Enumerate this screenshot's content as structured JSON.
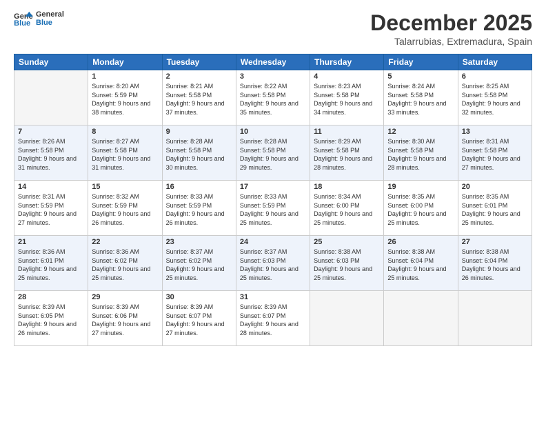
{
  "header": {
    "logo_line1": "General",
    "logo_line2": "Blue",
    "title": "December 2025",
    "subtitle": "Talarrubias, Extremadura, Spain"
  },
  "days_of_week": [
    "Sunday",
    "Monday",
    "Tuesday",
    "Wednesday",
    "Thursday",
    "Friday",
    "Saturday"
  ],
  "weeks": [
    [
      {
        "day": "",
        "sunrise": "",
        "sunset": "",
        "daylight": ""
      },
      {
        "day": "1",
        "sunrise": "Sunrise: 8:20 AM",
        "sunset": "Sunset: 5:59 PM",
        "daylight": "Daylight: 9 hours and 38 minutes."
      },
      {
        "day": "2",
        "sunrise": "Sunrise: 8:21 AM",
        "sunset": "Sunset: 5:58 PM",
        "daylight": "Daylight: 9 hours and 37 minutes."
      },
      {
        "day": "3",
        "sunrise": "Sunrise: 8:22 AM",
        "sunset": "Sunset: 5:58 PM",
        "daylight": "Daylight: 9 hours and 35 minutes."
      },
      {
        "day": "4",
        "sunrise": "Sunrise: 8:23 AM",
        "sunset": "Sunset: 5:58 PM",
        "daylight": "Daylight: 9 hours and 34 minutes."
      },
      {
        "day": "5",
        "sunrise": "Sunrise: 8:24 AM",
        "sunset": "Sunset: 5:58 PM",
        "daylight": "Daylight: 9 hours and 33 minutes."
      },
      {
        "day": "6",
        "sunrise": "Sunrise: 8:25 AM",
        "sunset": "Sunset: 5:58 PM",
        "daylight": "Daylight: 9 hours and 32 minutes."
      }
    ],
    [
      {
        "day": "7",
        "sunrise": "Sunrise: 8:26 AM",
        "sunset": "Sunset: 5:58 PM",
        "daylight": "Daylight: 9 hours and 31 minutes."
      },
      {
        "day": "8",
        "sunrise": "Sunrise: 8:27 AM",
        "sunset": "Sunset: 5:58 PM",
        "daylight": "Daylight: 9 hours and 31 minutes."
      },
      {
        "day": "9",
        "sunrise": "Sunrise: 8:28 AM",
        "sunset": "Sunset: 5:58 PM",
        "daylight": "Daylight: 9 hours and 30 minutes."
      },
      {
        "day": "10",
        "sunrise": "Sunrise: 8:28 AM",
        "sunset": "Sunset: 5:58 PM",
        "daylight": "Daylight: 9 hours and 29 minutes."
      },
      {
        "day": "11",
        "sunrise": "Sunrise: 8:29 AM",
        "sunset": "Sunset: 5:58 PM",
        "daylight": "Daylight: 9 hours and 28 minutes."
      },
      {
        "day": "12",
        "sunrise": "Sunrise: 8:30 AM",
        "sunset": "Sunset: 5:58 PM",
        "daylight": "Daylight: 9 hours and 28 minutes."
      },
      {
        "day": "13",
        "sunrise": "Sunrise: 8:31 AM",
        "sunset": "Sunset: 5:58 PM",
        "daylight": "Daylight: 9 hours and 27 minutes."
      }
    ],
    [
      {
        "day": "14",
        "sunrise": "Sunrise: 8:31 AM",
        "sunset": "Sunset: 5:59 PM",
        "daylight": "Daylight: 9 hours and 27 minutes."
      },
      {
        "day": "15",
        "sunrise": "Sunrise: 8:32 AM",
        "sunset": "Sunset: 5:59 PM",
        "daylight": "Daylight: 9 hours and 26 minutes."
      },
      {
        "day": "16",
        "sunrise": "Sunrise: 8:33 AM",
        "sunset": "Sunset: 5:59 PM",
        "daylight": "Daylight: 9 hours and 26 minutes."
      },
      {
        "day": "17",
        "sunrise": "Sunrise: 8:33 AM",
        "sunset": "Sunset: 5:59 PM",
        "daylight": "Daylight: 9 hours and 25 minutes."
      },
      {
        "day": "18",
        "sunrise": "Sunrise: 8:34 AM",
        "sunset": "Sunset: 6:00 PM",
        "daylight": "Daylight: 9 hours and 25 minutes."
      },
      {
        "day": "19",
        "sunrise": "Sunrise: 8:35 AM",
        "sunset": "Sunset: 6:00 PM",
        "daylight": "Daylight: 9 hours and 25 minutes."
      },
      {
        "day": "20",
        "sunrise": "Sunrise: 8:35 AM",
        "sunset": "Sunset: 6:01 PM",
        "daylight": "Daylight: 9 hours and 25 minutes."
      }
    ],
    [
      {
        "day": "21",
        "sunrise": "Sunrise: 8:36 AM",
        "sunset": "Sunset: 6:01 PM",
        "daylight": "Daylight: 9 hours and 25 minutes."
      },
      {
        "day": "22",
        "sunrise": "Sunrise: 8:36 AM",
        "sunset": "Sunset: 6:02 PM",
        "daylight": "Daylight: 9 hours and 25 minutes."
      },
      {
        "day": "23",
        "sunrise": "Sunrise: 8:37 AM",
        "sunset": "Sunset: 6:02 PM",
        "daylight": "Daylight: 9 hours and 25 minutes."
      },
      {
        "day": "24",
        "sunrise": "Sunrise: 8:37 AM",
        "sunset": "Sunset: 6:03 PM",
        "daylight": "Daylight: 9 hours and 25 minutes."
      },
      {
        "day": "25",
        "sunrise": "Sunrise: 8:38 AM",
        "sunset": "Sunset: 6:03 PM",
        "daylight": "Daylight: 9 hours and 25 minutes."
      },
      {
        "day": "26",
        "sunrise": "Sunrise: 8:38 AM",
        "sunset": "Sunset: 6:04 PM",
        "daylight": "Daylight: 9 hours and 25 minutes."
      },
      {
        "day": "27",
        "sunrise": "Sunrise: 8:38 AM",
        "sunset": "Sunset: 6:04 PM",
        "daylight": "Daylight: 9 hours and 26 minutes."
      }
    ],
    [
      {
        "day": "28",
        "sunrise": "Sunrise: 8:39 AM",
        "sunset": "Sunset: 6:05 PM",
        "daylight": "Daylight: 9 hours and 26 minutes."
      },
      {
        "day": "29",
        "sunrise": "Sunrise: 8:39 AM",
        "sunset": "Sunset: 6:06 PM",
        "daylight": "Daylight: 9 hours and 27 minutes."
      },
      {
        "day": "30",
        "sunrise": "Sunrise: 8:39 AM",
        "sunset": "Sunset: 6:07 PM",
        "daylight": "Daylight: 9 hours and 27 minutes."
      },
      {
        "day": "31",
        "sunrise": "Sunrise: 8:39 AM",
        "sunset": "Sunset: 6:07 PM",
        "daylight": "Daylight: 9 hours and 28 minutes."
      },
      {
        "day": "",
        "sunrise": "",
        "sunset": "",
        "daylight": ""
      },
      {
        "day": "",
        "sunrise": "",
        "sunset": "",
        "daylight": ""
      },
      {
        "day": "",
        "sunrise": "",
        "sunset": "",
        "daylight": ""
      }
    ]
  ]
}
